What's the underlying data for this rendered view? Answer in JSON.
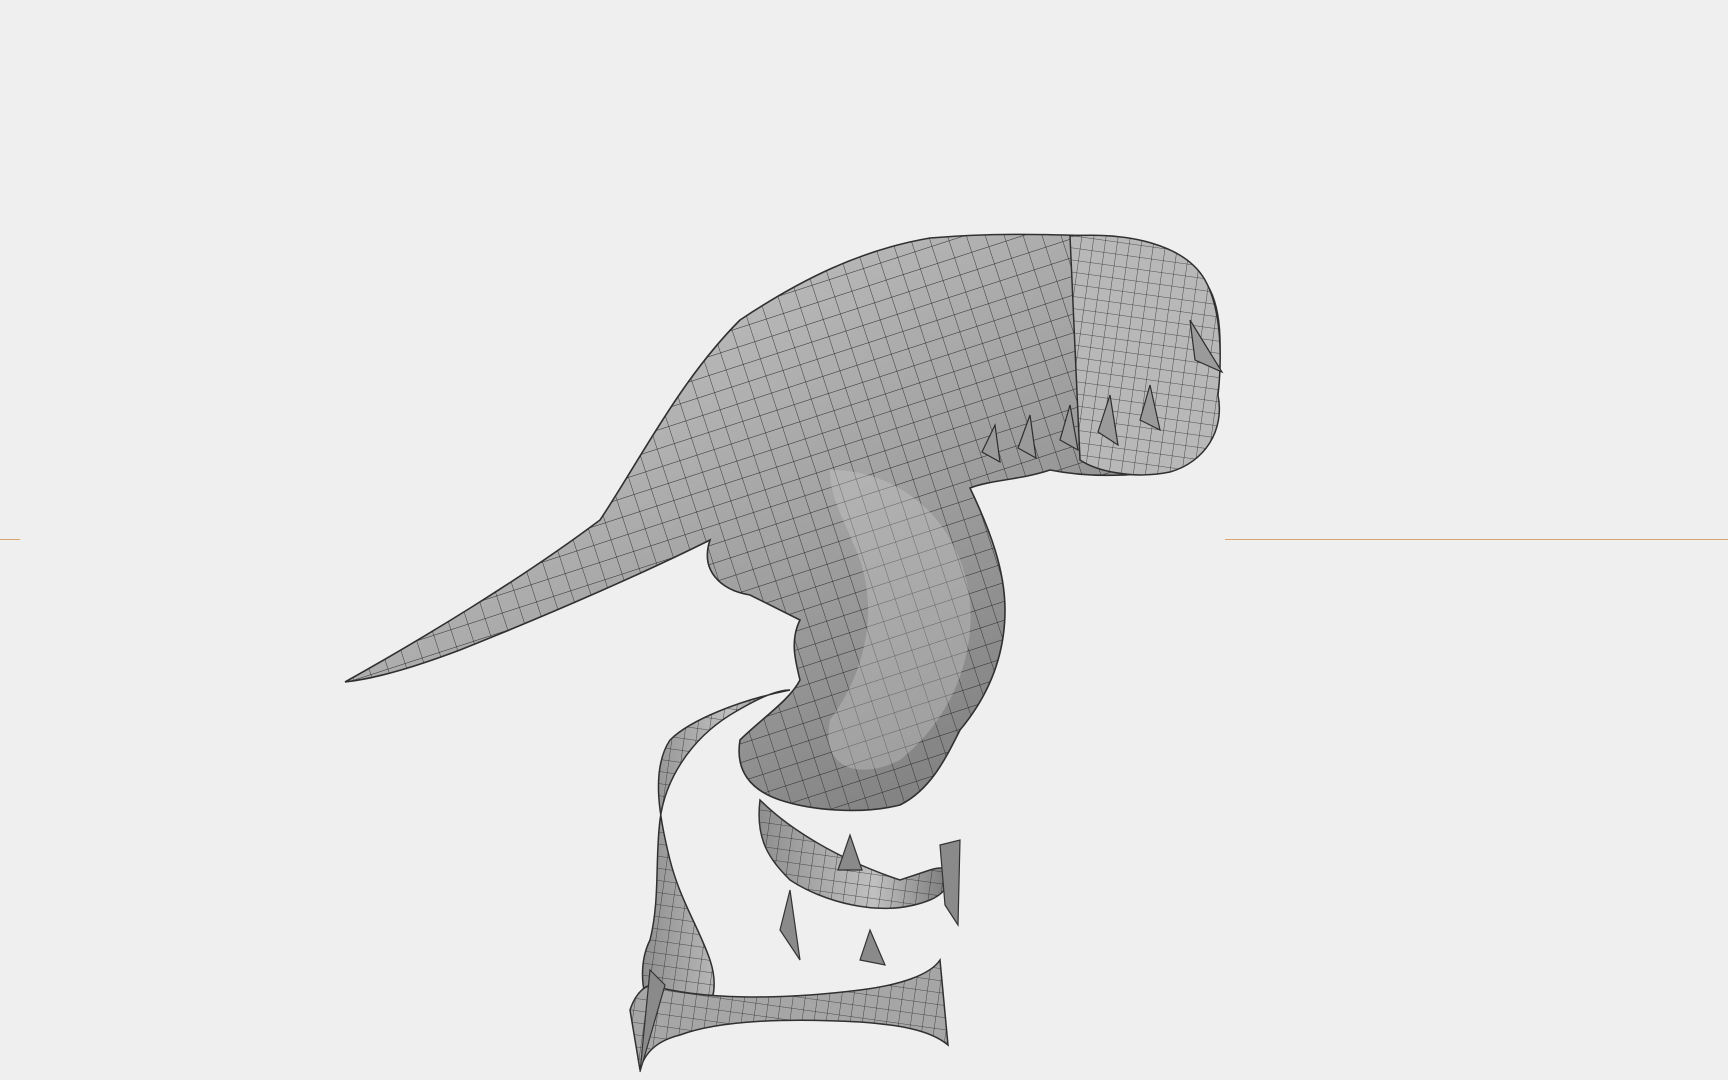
{
  "viewport": {
    "background": "#efefef",
    "horizon_color": "#d9a56a",
    "mesh_fill": "#a9a9a9",
    "mesh_wire": "#2a2a2a",
    "subject": "dinosaur-wireframe-mesh"
  }
}
